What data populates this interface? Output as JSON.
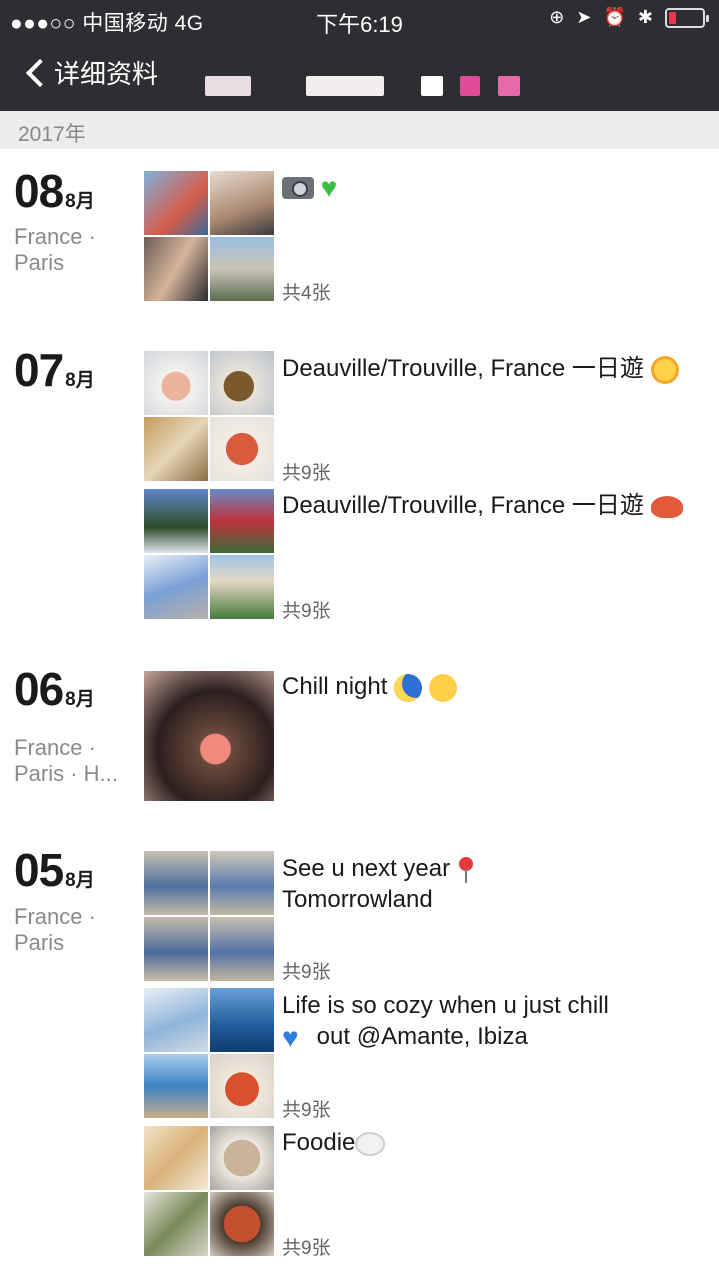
{
  "status_bar": {
    "carrier": "●●●○○ 中国移动  4G",
    "time": "下午6:19"
  },
  "nav": {
    "back_label": "详细资料"
  },
  "year": "2017年",
  "entries": [
    {
      "day": "08",
      "month": "8月",
      "location": "France · Paris",
      "posts": [
        {
          "caption": "",
          "count": "共4张",
          "icons": [
            "camera-icon",
            "green-heart-icon"
          ]
        }
      ]
    },
    {
      "day": "07",
      "month": "8月",
      "location": "",
      "posts": [
        {
          "caption": "Deauville/Trouville, France 一日遊",
          "count": "共9张",
          "icons": [
            "sun-face-icon"
          ]
        },
        {
          "caption": "Deauville/Trouville, France 一日遊",
          "count": "共9张",
          "icons": [
            "crab-icon"
          ]
        }
      ]
    },
    {
      "day": "06",
      "month": "8月",
      "location": "France · Paris · H...",
      "posts": [
        {
          "caption": "Chill night",
          "count": "",
          "icons": [
            "crescent-moon-icon",
            "sleepy-face-icon"
          ]
        }
      ]
    },
    {
      "day": "05",
      "month": "8月",
      "location": "France · Paris",
      "posts": [
        {
          "caption": "See u next year",
          "caption_line2": "Tomorrowland",
          "count": "共9张",
          "icons": [
            "pin-icon"
          ]
        },
        {
          "caption": "Life is so cozy when u just chill",
          "caption_line2": "out @Amante, Ibiza",
          "count": "共9张",
          "icons": [
            "blue-heart-icon"
          ]
        },
        {
          "caption": "Foodie",
          "count": "共9张",
          "icons": [
            "plate-icon"
          ]
        }
      ]
    }
  ]
}
